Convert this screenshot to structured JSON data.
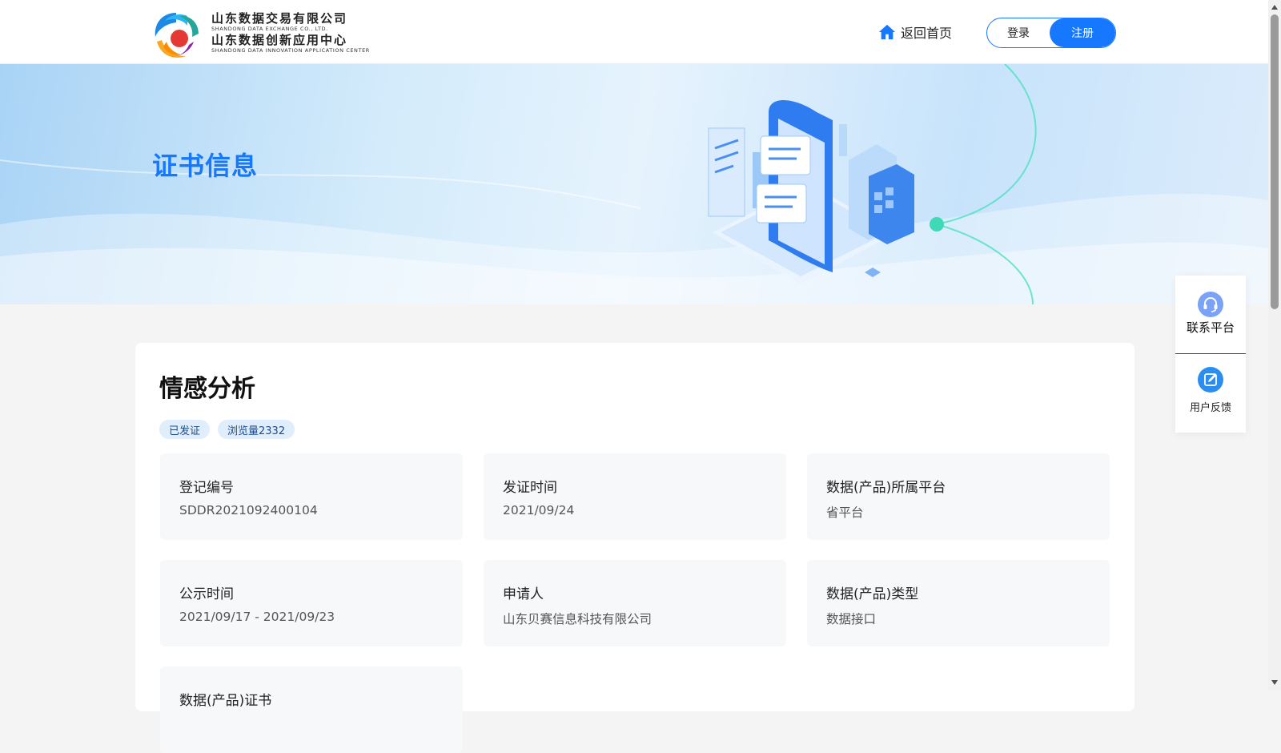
{
  "header": {
    "logo": {
      "line1_cn": "山东数据交易有限公司",
      "line1_en": "SHANDONG DATA EXCHANGE CO., LTD.",
      "line2_cn": "山东数据创新应用中心",
      "line2_en": "SHANDONG DATA INNOVATION APPLICATION CENTER"
    },
    "home_label": "返回首页",
    "login_label": "登录",
    "register_label": "注册"
  },
  "banner": {
    "title": "证书信息"
  },
  "main": {
    "title": "情感分析",
    "tags": [
      "已发证",
      "浏览量2332"
    ],
    "fields": [
      {
        "label": "登记编号",
        "value": "SDDR2021092400104"
      },
      {
        "label": "发证时间",
        "value": "2021/09/24"
      },
      {
        "label": "数据(产品)所属平台",
        "value": "省平台"
      },
      {
        "label": "公示时间",
        "value": "2021/09/17 - 2021/09/23"
      },
      {
        "label": "申请人",
        "value": "山东贝赛信息科技有限公司"
      },
      {
        "label": "数据(产品)类型",
        "value": "数据接口"
      },
      {
        "label": "数据(产品)证书",
        "value": ""
      }
    ]
  },
  "side_float": {
    "contact_label": "联系平台",
    "feedback_label": "用户反馈"
  },
  "icons": {
    "home": "home-icon",
    "contact": "headset-icon",
    "feedback": "edit-icon"
  },
  "colors": {
    "accent": "#1677ff",
    "tag_bg": "#e0edfb",
    "card_bg": "#f7f8fa"
  }
}
